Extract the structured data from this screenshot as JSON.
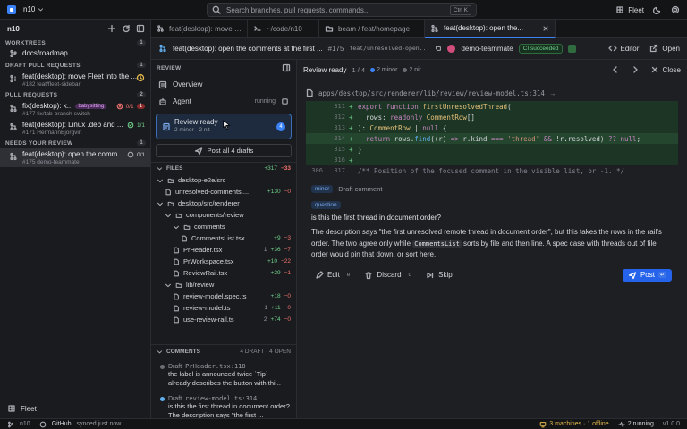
{
  "titlebar": {
    "repo": "n10",
    "search_placeholder": "Search branches, pull requests, commands...",
    "search_shortcut": "Ctrl K",
    "account": "Fleet"
  },
  "sidebar": {
    "title": "n10",
    "sections": [
      {
        "label": "WORKTREES",
        "count": "1"
      },
      {
        "label": "DRAFT PULL REQUESTS",
        "count": "1"
      },
      {
        "label": "PULL REQUESTS",
        "count": "2"
      },
      {
        "label": "NEEDS YOUR REVIEW",
        "count": "1"
      }
    ],
    "worktree": {
      "label": "docs/roadmap"
    },
    "draft": {
      "title": "feat(desktop): move Fleet into the ...",
      "meta": "#182  feat/fleet-sidebar"
    },
    "prs": [
      {
        "title": "fix(desktop): k...",
        "tag": "babysitting",
        "meta": "#177  fix/tab-branch-switch",
        "status": "0/1",
        "status2": "1"
      },
      {
        "title": "feat(desktop): Linux .deb and ...",
        "meta": "#171  HermannBjorgvin",
        "status": "1/1"
      }
    ],
    "review": {
      "title": "feat(desktop): open the comm...",
      "meta": "#175  demo-teammate",
      "status": "0/1"
    },
    "footer": "Fleet"
  },
  "tabs": [
    {
      "label": "feat(desktop): move Fle..."
    },
    {
      "label": "~/code/n10"
    },
    {
      "label": "beam / feat/homepage"
    },
    {
      "label": "feat(desktop): open the..."
    }
  ],
  "pr_header": {
    "title": "feat(desktop): open the comments at the first ...",
    "number": "#175",
    "branch": "feat/unresolved-open...",
    "author": "demo-teammate",
    "ci": "CI succeeded",
    "editor": "Editor",
    "open": "Open"
  },
  "review_panel": {
    "title": "REVIEW",
    "overview": "Overview",
    "agent": "Agent",
    "agent_status": "running",
    "card": {
      "title": "Review ready",
      "subtitle": "2 minor · 2 nit",
      "badge": "4"
    },
    "post_all": "Post all 4 drafts",
    "files_label": "FILES",
    "files_add": "+317",
    "files_del": "−33",
    "tree": [
      {
        "name": "desktop-e2e/src",
        "kind": "dir",
        "depth": 0
      },
      {
        "name": "unresolved-comments....",
        "kind": "file",
        "depth": 1,
        "add": "+130",
        "del": "−0"
      },
      {
        "name": "desktop/src/renderer",
        "kind": "dir",
        "depth": 0
      },
      {
        "name": "components/review",
        "kind": "dir",
        "depth": 1
      },
      {
        "name": "comments",
        "kind": "dir",
        "depth": 2
      },
      {
        "name": "CommentsList.tsx",
        "kind": "file",
        "depth": 3,
        "add": "+9",
        "del": "−3"
      },
      {
        "name": "PrHeader.tsx",
        "kind": "file",
        "depth": 2,
        "pre": "1",
        "add": "+36",
        "del": "−7"
      },
      {
        "name": "PrWorkspace.tsx",
        "kind": "file",
        "depth": 2,
        "add": "+10",
        "del": "−22"
      },
      {
        "name": "ReviewRail.tsx",
        "kind": "file",
        "depth": 2,
        "add": "+29",
        "del": "−1"
      },
      {
        "name": "lib/review",
        "kind": "dir",
        "depth": 1
      },
      {
        "name": "review-model.spec.ts",
        "kind": "file",
        "depth": 2,
        "add": "+18",
        "del": "−0"
      },
      {
        "name": "review-model.ts",
        "kind": "file",
        "depth": 2,
        "pre": "1",
        "add": "+11",
        "del": "−0"
      },
      {
        "name": "use-review-rail.ts",
        "kind": "file",
        "depth": 2,
        "pre": "2",
        "add": "+74",
        "del": "−0"
      }
    ],
    "comments_label": "COMMENTS",
    "comments_meta": "4 DRAFT · 4 OPEN",
    "comments": [
      {
        "status": "Draft",
        "file": "PrHeader.tsx:118",
        "body": "the label is announced twice `Tip` already describes the button with thi..."
      },
      {
        "status": "Draft",
        "file": "review-model.ts:314",
        "body": "is this the first thread in document order? The description says \"the first ..."
      }
    ]
  },
  "main": {
    "header": {
      "title": "Review ready",
      "position": "1 / 4",
      "minor": "2 minor",
      "nit": "2 nit",
      "close": "Close"
    },
    "path": "apps/desktop/src/renderer/lib/review/review-model.ts:314",
    "code": [
      {
        "old": "",
        "new": "311",
        "mark": "+",
        "html_key": "l311"
      },
      {
        "old": "",
        "new": "312",
        "mark": "+",
        "html_key": "l312"
      },
      {
        "old": "",
        "new": "313",
        "mark": "+",
        "html_key": "l313"
      },
      {
        "old": "",
        "new": "314",
        "mark": "+",
        "html_key": "l314"
      },
      {
        "old": "",
        "new": "315",
        "mark": "+",
        "html_key": "l315"
      },
      {
        "old": "",
        "new": "316",
        "mark": "+",
        "html_key": "l316"
      },
      {
        "old": "306",
        "new": "317",
        "mark": "",
        "html_key": "l317"
      }
    ],
    "code_text": {
      "l311": "export function firstUnresolvedThread(",
      "l312": "  rows: readonly CommentRow[]",
      "l313": "): CommentRow | null {",
      "l314": "  return rows.find((r) => r.kind === 'thread' && !r.resolved) ?? null;",
      "l315": "}",
      "l316": "",
      "l317": "/** Position of the focused comment in the visible list, or -1. */"
    },
    "thread": {
      "severity": "minor",
      "draft_label": "Draft comment",
      "kind": "question",
      "question": "is this the first thread in document order?",
      "desc_a": "The description says \"the first unresolved remote thread in document order\", but this takes the rows in the rail's order. The two agree only while ",
      "desc_code": "CommentsList",
      "desc_b": " sorts by file and then line. A spec case with threads out of file order would pin that down, or sort here."
    },
    "actions": {
      "edit": "Edit",
      "edit_kb": "e",
      "discard": "Discard",
      "discard_kb": "d",
      "skip": "Skip",
      "post": "Post",
      "post_kb": "↵"
    }
  },
  "statusbar": {
    "branch": "n10",
    "provider": "GitHub",
    "sync": "synced just now",
    "machines": "3 machines · 1 offline",
    "running": "2 running",
    "version": "v1.0.0"
  },
  "colors": {
    "accent": "#3b82f6",
    "add": "#6fd08c",
    "del": "#f2736e",
    "warn": "#e5b84d"
  }
}
